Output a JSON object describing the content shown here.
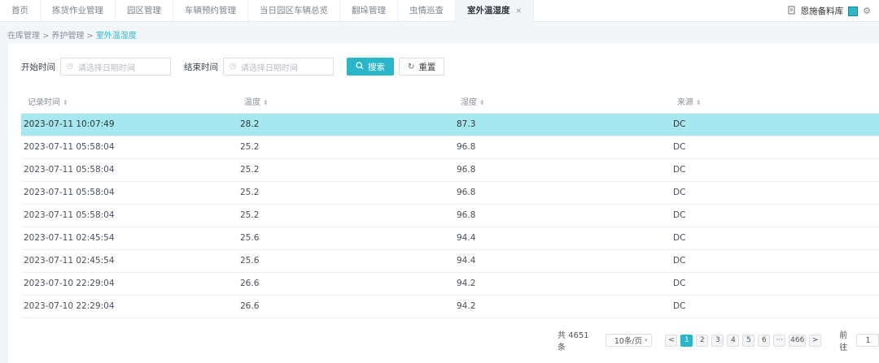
{
  "tabs": [
    {
      "label": "首页"
    },
    {
      "label": "拣货作业管理"
    },
    {
      "label": "园区管理"
    },
    {
      "label": "车辆预约管理"
    },
    {
      "label": "当日园区车辆总览"
    },
    {
      "label": "翻垛管理"
    },
    {
      "label": "虫情巡查"
    },
    {
      "label": "室外温湿度",
      "active": true,
      "close": "×"
    }
  ],
  "header": {
    "user_name": "恩施备料库",
    "accent_color": "#2eb6c8",
    "doc_icon": "document-icon",
    "settings_icon": "gear-icon"
  },
  "breadcrumb": {
    "items": [
      "在库管理",
      "养护管理",
      "室外温湿度"
    ],
    "separator": ">"
  },
  "filters": {
    "start_label": "开始时间",
    "start_placeholder": "请选择日期时间",
    "end_label": "结束时间",
    "end_placeholder": "请选择日期时间",
    "search_label": "搜索",
    "reset_label": "重置"
  },
  "table": {
    "columns": [
      "记录时间",
      "温度",
      "湿度",
      "来源"
    ],
    "rows": [
      [
        "2023-07-11 10:07:49",
        "28.2",
        "87.3",
        "DC"
      ],
      [
        "2023-07-11 05:58:04",
        "25.2",
        "96.8",
        "DC"
      ],
      [
        "2023-07-11 05:58:04",
        "25.2",
        "96.8",
        "DC"
      ],
      [
        "2023-07-11 05:58:04",
        "25.2",
        "96.8",
        "DC"
      ],
      [
        "2023-07-11 05:58:04",
        "25.2",
        "96.8",
        "DC"
      ],
      [
        "2023-07-11 02:45:54",
        "25.6",
        "94.4",
        "DC"
      ],
      [
        "2023-07-11 02:45:54",
        "25.6",
        "94.4",
        "DC"
      ],
      [
        "2023-07-10 22:29:04",
        "26.6",
        "94.2",
        "DC"
      ],
      [
        "2023-07-10 22:29:04",
        "26.6",
        "94.2",
        "DC"
      ]
    ],
    "highlight_color": "#a6e8ef"
  },
  "pagination": {
    "total_text": "共 4651 条",
    "page_size": "10条/页",
    "prev": "<",
    "pages": [
      "1",
      "2",
      "3",
      "4",
      "5",
      "6"
    ],
    "ellipsis": "···",
    "last_page": "466",
    "next": ">",
    "goto_label": "前往",
    "goto_value": "1"
  }
}
